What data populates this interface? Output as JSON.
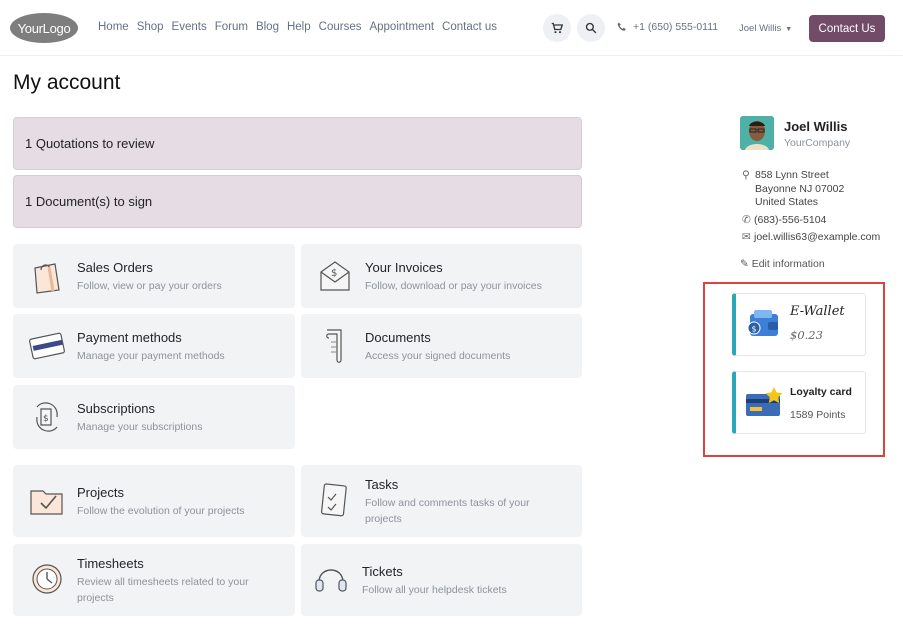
{
  "header": {
    "logo_text": "YourLogo",
    "nav": [
      "Home",
      "Shop",
      "Events",
      "Forum",
      "Blog",
      "Help",
      "Courses",
      "Appointment",
      "Contact us"
    ],
    "phone": "+1 (650) 555-0111",
    "user_menu": "Joel Willis",
    "contact_button": "Contact Us",
    "accent_color": "#714b67"
  },
  "page": {
    "title": "My account"
  },
  "alerts": [
    "1 Quotations to review",
    "1 Document(s) to sign"
  ],
  "cards": [
    {
      "title": "Sales Orders",
      "desc": "Follow, view or pay your orders",
      "icon": "shopping-bag-icon"
    },
    {
      "title": "Your Invoices",
      "desc": "Follow, download or pay your invoices",
      "icon": "invoice-envelope-icon"
    },
    {
      "title": "Payment methods",
      "desc": "Manage your payment methods",
      "icon": "credit-card-icon"
    },
    {
      "title": "Documents",
      "desc": "Access your signed documents",
      "icon": "document-icon"
    },
    {
      "title": "Subscriptions",
      "desc": "Manage your subscriptions",
      "icon": "subscription-icon"
    },
    {
      "title": "Projects",
      "desc": "Follow the evolution of your projects",
      "icon": "folder-check-icon"
    },
    {
      "title": "Tasks",
      "desc": "Follow and comments tasks of your projects",
      "icon": "task-clipboard-icon"
    },
    {
      "title": "Timesheets",
      "desc": "Review all timesheets related to your projects",
      "icon": "clock-icon"
    },
    {
      "title": "Tickets",
      "desc": "Follow all your helpdesk tickets",
      "icon": "headset-icon"
    }
  ],
  "profile": {
    "name": "Joel Willis",
    "company": "YourCompany",
    "address": [
      "858 Lynn Street",
      "Bayonne NJ 07002",
      "United States"
    ],
    "phone": "(683)-556-5104",
    "email": "joel.willis63@example.com",
    "edit_label": "Edit information"
  },
  "ewallet": {
    "title": "E-Wallet",
    "amount": "$0.23",
    "icon": "wallet-icon"
  },
  "loyalty": {
    "title": "Loyalty card",
    "points": "1589 Points",
    "icon": "loyalty-card-icon"
  },
  "colors": {
    "alert_bg": "#e6dde4",
    "card_bg": "#f2f3f5",
    "highlight": "#d9453e",
    "side_accent": "#2aa7b8"
  }
}
